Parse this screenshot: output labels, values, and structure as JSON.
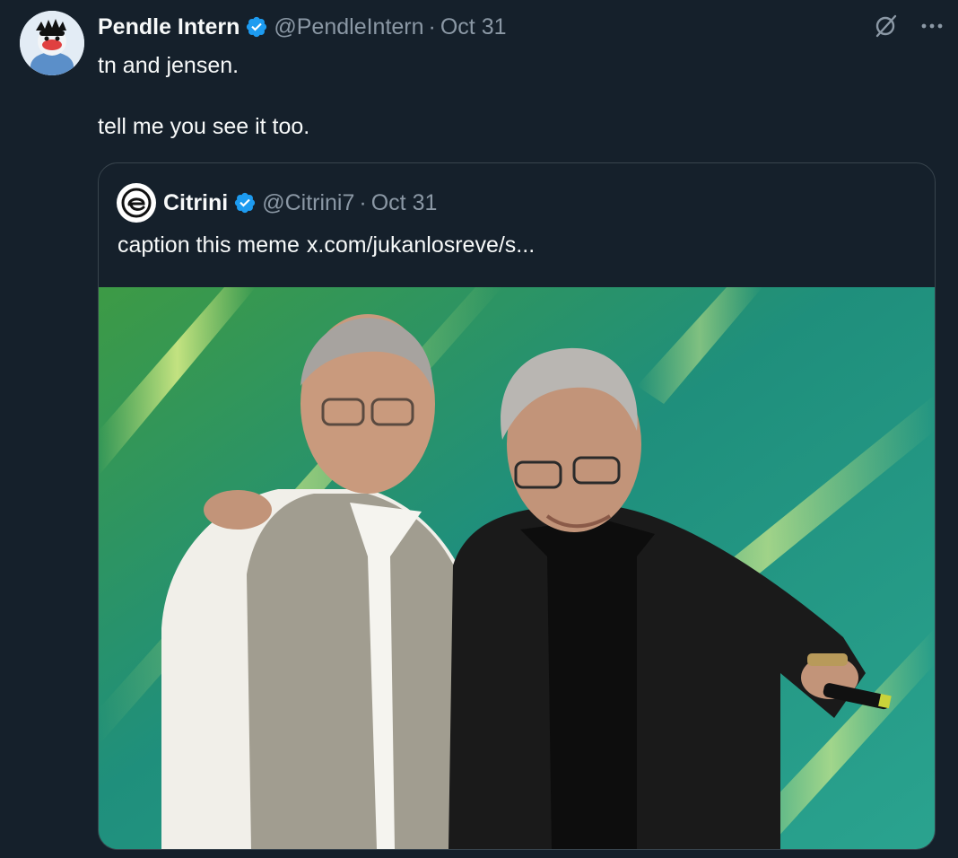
{
  "tweet": {
    "author": {
      "display_name": "Pendle Intern",
      "handle": "@PendleIntern",
      "avatar_icon": "cartoon-character-avatar",
      "verified_icon": "verified-badge-icon"
    },
    "separator": "·",
    "date": "Oct 31",
    "text": "tn and jensen.\n\ntell me you see it too.",
    "actions": {
      "grok_icon": "slashed-circle-icon",
      "more_icon": "more-dots-icon"
    }
  },
  "quote": {
    "author": {
      "display_name": "Citrini",
      "handle": "@Citrini7",
      "avatar_icon": "citrini-logo-avatar"
    },
    "separator": "·",
    "date": "Oct 31",
    "text": "caption this meme",
    "link": "x.com/jukanlosreve/s...",
    "media": {
      "type": "photo",
      "icon": "photo-two-men-on-stage"
    }
  },
  "colors": {
    "background": "#15202b",
    "text_primary": "#f7f9f9",
    "text_secondary": "#8b98a5",
    "verified_blue": "#1d9bf0",
    "border": "#38444d"
  }
}
